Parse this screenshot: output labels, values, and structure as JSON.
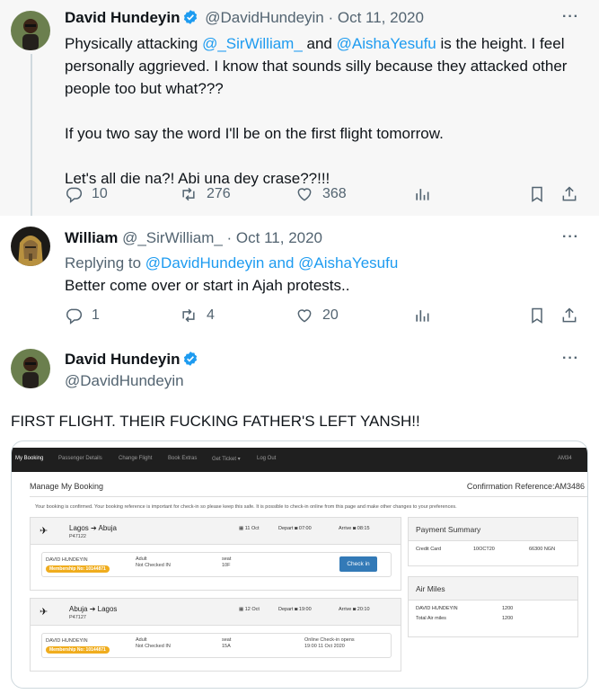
{
  "tweets": [
    {
      "author": "David Hundeyin",
      "handle": "@DavidHundeyin",
      "date": "· Oct 11, 2020",
      "text_before_mention1": "Physically attacking ",
      "mention1": "@_SirWilliam_",
      "text_between": " and ",
      "mention2": "@AishaYesufu",
      "text_after": " is the height. I feel personally aggrieved. I know that sounds silly because they attacked other people too but what???",
      "para2": "If you two say the word I'll be on the first flight tomorrow.",
      "para3": "Let's all die na?! Abi una dey crase??!!!",
      "replies": "10",
      "retweets": "276",
      "likes": "368"
    },
    {
      "author": "William",
      "handle": "@_SirWilliam_",
      "date": "· Oct 11, 2020",
      "replying_prefix": "Replying to ",
      "replying_to": "@DavidHundeyin and @AishaYesufu",
      "text": "Better come over or start in Ajah protests..",
      "replies": "1",
      "retweets": "4",
      "likes": "20"
    },
    {
      "author": "David Hundeyin",
      "handle": "@DavidHundeyin",
      "text": "FIRST FLIGHT. THEIR FUCKING FATHER'S LEFT YANSH!!"
    }
  ],
  "booking": {
    "nav": [
      "My Booking",
      "Passenger Details",
      "Change Flight",
      "Book Extras",
      "Get Ticket ▾",
      "Log Out"
    ],
    "nav_right": "AM34",
    "title": "Manage My Booking",
    "confirmation": "Confirmation Reference:AM3486",
    "info": "Your booking is confirmed. Your booking reference is important for check-in so please keep this safe. It is possible to check-in online from this page and make other changes to your preferences.",
    "flights": [
      {
        "route_from": "Lagos",
        "route_to": "Abuja",
        "number": "P47122",
        "date": "11 Oct",
        "depart": "Depart",
        "depart_time": "07:00",
        "arrive": "Arrive",
        "arrive_time": "08:15",
        "passenger": "DAVID HUNDEYIN",
        "membership": "Membership No: 10144871",
        "type": "Adult",
        "status": "Not Checked IN",
        "seat_label": "seat",
        "seat": "10F",
        "action": "Check in"
      },
      {
        "route_from": "Abuja",
        "route_to": "Lagos",
        "number": "P47127",
        "date": "12 Oct",
        "depart": "Depart",
        "depart_time": "19:00",
        "arrive": "Arrive",
        "arrive_time": "20:10",
        "passenger": "DAVID HUNDEYIN",
        "membership": "Membership No: 10144871",
        "type": "Adult",
        "status": "Not Checked IN",
        "seat_label": "seat",
        "seat": "15A",
        "online_checkin": "Online Check-in opens",
        "online_checkin_time": "19:00 11 Oct 2020"
      }
    ],
    "payment": {
      "title": "Payment Summary",
      "method": "Credit Card",
      "date": "10OCT20",
      "amount": "66300 NGN"
    },
    "airmiles": {
      "title": "Air Miles",
      "name": "DAVID HUNDEYIN",
      "miles": "1200",
      "total_label": "Total Air miles",
      "total": "1200"
    }
  },
  "colors": {
    "accent": "#1d9bf0",
    "muted": "#536471",
    "badge": "#f0ad1e",
    "button": "#337ab7"
  }
}
